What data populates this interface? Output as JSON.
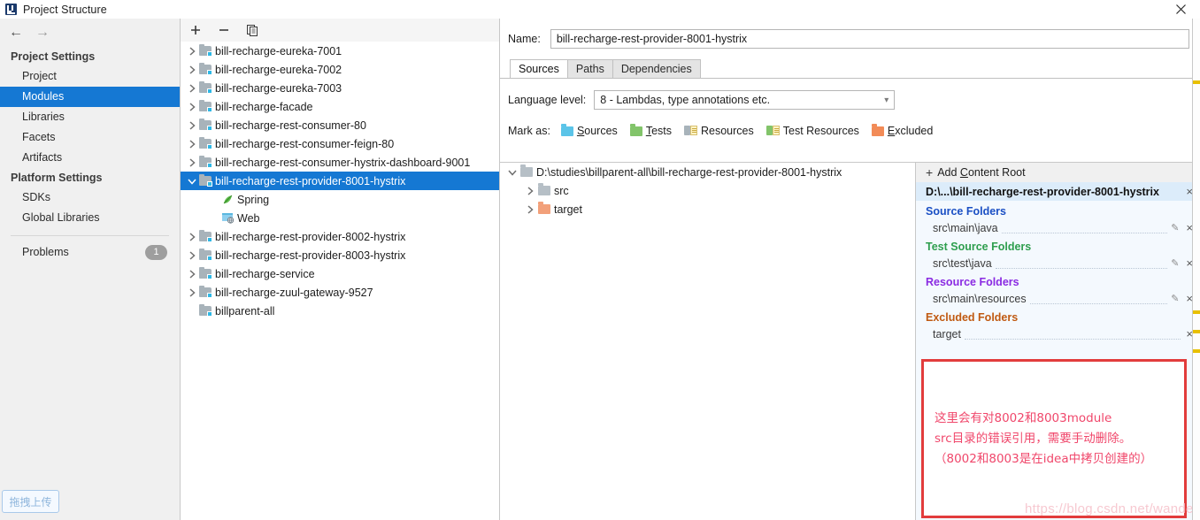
{
  "window": {
    "title": "Project Structure",
    "app_icon": "intellij-idea-icon",
    "close_label": "×"
  },
  "sidebar": {
    "back_icon": "back-arrow-icon",
    "forward_icon": "forward-arrow-icon",
    "groups": [
      {
        "title": "Project Settings",
        "items": [
          {
            "label": "Project",
            "selected": false
          },
          {
            "label": "Modules",
            "selected": true
          },
          {
            "label": "Libraries",
            "selected": false
          },
          {
            "label": "Facets",
            "selected": false
          },
          {
            "label": "Artifacts",
            "selected": false
          }
        ]
      },
      {
        "title": "Platform Settings",
        "items": [
          {
            "label": "SDKs",
            "selected": false
          },
          {
            "label": "Global Libraries",
            "selected": false
          }
        ]
      }
    ],
    "problems": {
      "label": "Problems",
      "count": "1"
    },
    "upload_chip": "拖拽上传"
  },
  "modules_panel": {
    "toolbar": {
      "add_label": "+",
      "remove_label": "−",
      "copy_label": "copy"
    },
    "tree": [
      {
        "label": "bill-recharge-eureka-7001",
        "indent": 0,
        "twisty": "collapsed",
        "icon": "module-icon",
        "selected": false
      },
      {
        "label": "bill-recharge-eureka-7002",
        "indent": 0,
        "twisty": "collapsed",
        "icon": "module-icon",
        "selected": false
      },
      {
        "label": "bill-recharge-eureka-7003",
        "indent": 0,
        "twisty": "collapsed",
        "icon": "module-icon",
        "selected": false
      },
      {
        "label": "bill-recharge-facade",
        "indent": 0,
        "twisty": "collapsed",
        "icon": "module-icon",
        "selected": false
      },
      {
        "label": "bill-recharge-rest-consumer-80",
        "indent": 0,
        "twisty": "collapsed",
        "icon": "module-icon",
        "selected": false
      },
      {
        "label": "bill-recharge-rest-consumer-feign-80",
        "indent": 0,
        "twisty": "collapsed",
        "icon": "module-icon",
        "selected": false
      },
      {
        "label": "bill-recharge-rest-consumer-hystrix-dashboard-9001",
        "indent": 0,
        "twisty": "collapsed",
        "icon": "module-icon",
        "selected": false
      },
      {
        "label": "bill-recharge-rest-provider-8001-hystrix",
        "indent": 0,
        "twisty": "expanded",
        "icon": "module-icon",
        "selected": true
      },
      {
        "label": "Spring",
        "indent": 1,
        "twisty": "none",
        "icon": "spring-leaf-icon",
        "selected": false
      },
      {
        "label": "Web",
        "indent": 1,
        "twisty": "none",
        "icon": "web-facet-icon",
        "selected": false
      },
      {
        "label": "bill-recharge-rest-provider-8002-hystrix",
        "indent": 0,
        "twisty": "collapsed",
        "icon": "module-icon",
        "selected": false
      },
      {
        "label": "bill-recharge-rest-provider-8003-hystrix",
        "indent": 0,
        "twisty": "collapsed",
        "icon": "module-icon",
        "selected": false
      },
      {
        "label": "bill-recharge-service",
        "indent": 0,
        "twisty": "collapsed",
        "icon": "module-icon",
        "selected": false
      },
      {
        "label": "bill-recharge-zuul-gateway-9527",
        "indent": 0,
        "twisty": "collapsed",
        "icon": "module-icon",
        "selected": false
      },
      {
        "label": "billparent-all",
        "indent": 0,
        "twisty": "none",
        "icon": "module-icon",
        "selected": false
      }
    ]
  },
  "detail": {
    "name_label": "Name:",
    "name_value": "bill-recharge-rest-provider-8001-hystrix",
    "tabs": [
      {
        "label": "Sources",
        "active": true
      },
      {
        "label": "Paths",
        "active": false
      },
      {
        "label": "Dependencies",
        "active": false
      }
    ],
    "language_level_label": "Language level:",
    "language_level_value": "8 - Lambdas, type annotations etc.",
    "mark_as_label": "Mark as:",
    "mark_as": [
      {
        "label": "Sources",
        "mnemonic": "S",
        "rest": "ources",
        "icon": "sources-folder-icon"
      },
      {
        "label": "Tests",
        "mnemonic": "T",
        "rest": "ests",
        "icon": "tests-folder-icon"
      },
      {
        "label": "Resources",
        "mnemonic": "R",
        "rest": "esources",
        "icon": "resources-folder-icon"
      },
      {
        "label": "Test Resources",
        "mnemonic": "",
        "rest": "Test Resources",
        "icon": "test-resources-folder-icon"
      },
      {
        "label": "Excluded",
        "mnemonic": "E",
        "rest": "xcluded",
        "icon": "excluded-folder-icon"
      }
    ],
    "content_tree": [
      {
        "label": "D:\\studies\\billparent-all\\bill-recharge-rest-provider-8001-hystrix",
        "indent": 0,
        "twisty": "expanded",
        "icon": "grey-folder-icon"
      },
      {
        "label": "src",
        "indent": 1,
        "twisty": "collapsed",
        "icon": "grey-folder-icon"
      },
      {
        "label": "target",
        "indent": 1,
        "twisty": "collapsed",
        "icon": "excluded-folder-icon"
      }
    ]
  },
  "root_panel": {
    "add_content_root": {
      "mnemonic_pre": "Add ",
      "mnemonic": "C",
      "mnemonic_post": "ontent Root"
    },
    "content_root_path": "D:\\...\\bill-recharge-rest-provider-8001-hystrix",
    "remove_icon": "×",
    "groups": [
      {
        "title": "Source Folders",
        "color": "#1a4fc4",
        "cls": "src",
        "items": [
          {
            "path": "src\\main\\java",
            "editable": true
          }
        ]
      },
      {
        "title": "Test Source Folders",
        "color": "#2e9e4e",
        "cls": "tst",
        "items": [
          {
            "path": "src\\test\\java",
            "editable": true
          }
        ]
      },
      {
        "title": "Resource Folders",
        "color": "#8a2be2",
        "cls": "res",
        "items": [
          {
            "path": "src\\main\\resources",
            "editable": true
          }
        ]
      },
      {
        "title": "Excluded Folders",
        "color": "#c05a12",
        "cls": "exc",
        "items": [
          {
            "path": "target",
            "editable": false
          }
        ]
      }
    ],
    "note": "这里会有对8002和8003module\nsrc目录的错误引用，需要手动删除。\n（8002和8003是在idea中拷贝创建的）",
    "watermark": "https://blog.csdn.net/wander"
  },
  "colors": {
    "accent_selection": "#1578d3",
    "note_border": "#e23c3c",
    "note_text": "#f0476b",
    "source_blue": "#1a4fc4",
    "test_green": "#2e9e4e",
    "resource_purple": "#8a2be2",
    "excluded_orange": "#c05a12"
  }
}
